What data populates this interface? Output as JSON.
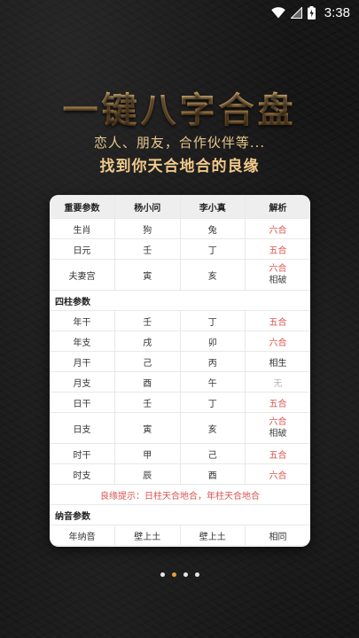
{
  "status": {
    "time": "3:38"
  },
  "hero": {
    "title": "一键八字合盘",
    "subtitle1": "恋人、朋友，合作伙伴等...",
    "subtitle2": "找到你天合地合的良缘"
  },
  "table": {
    "headers": [
      "重要参数",
      "杨小问",
      "李小真",
      "解析"
    ],
    "rows1": [
      {
        "param": "生肖",
        "a": "狗",
        "b": "兔",
        "result": [
          "六合"
        ],
        "color": "red"
      },
      {
        "param": "日元",
        "a": "壬",
        "b": "丁",
        "result": [
          "五合"
        ],
        "color": "red"
      },
      {
        "param": "夫妻宫",
        "a": "寅",
        "b": "亥",
        "result": [
          "六合",
          "相破"
        ],
        "color": "mixed"
      }
    ],
    "section_sizhu": "四柱参数",
    "rows2": [
      {
        "param": "年干",
        "a": "壬",
        "b": "丁",
        "result": [
          "五合"
        ],
        "color": "red"
      },
      {
        "param": "年支",
        "a": "戌",
        "b": "卯",
        "result": [
          "六合"
        ],
        "color": "red"
      },
      {
        "param": "月干",
        "a": "己",
        "b": "丙",
        "result": [
          "相生"
        ],
        "color": "normal"
      },
      {
        "param": "月支",
        "a": "酉",
        "b": "午",
        "result": [
          "无"
        ],
        "color": "dim"
      },
      {
        "param": "日干",
        "a": "壬",
        "b": "丁",
        "result": [
          "五合"
        ],
        "color": "red"
      },
      {
        "param": "日支",
        "a": "寅",
        "b": "亥",
        "result": [
          "六合",
          "相破"
        ],
        "color": "mixed"
      },
      {
        "param": "时干",
        "a": "甲",
        "b": "己",
        "result": [
          "五合"
        ],
        "color": "red"
      },
      {
        "param": "时支",
        "a": "辰",
        "b": "酉",
        "result": [
          "六合"
        ],
        "color": "red"
      }
    ],
    "note": "良缘提示：日柱天合地合，年柱天合地合",
    "section_nayin": "纳音参数",
    "rows3": [
      {
        "param": "年纳音",
        "a": "壁上土",
        "b": "壁上土",
        "result": [
          "相同"
        ],
        "color": "normal"
      }
    ]
  },
  "pager": {
    "count": 4,
    "active": 1
  }
}
